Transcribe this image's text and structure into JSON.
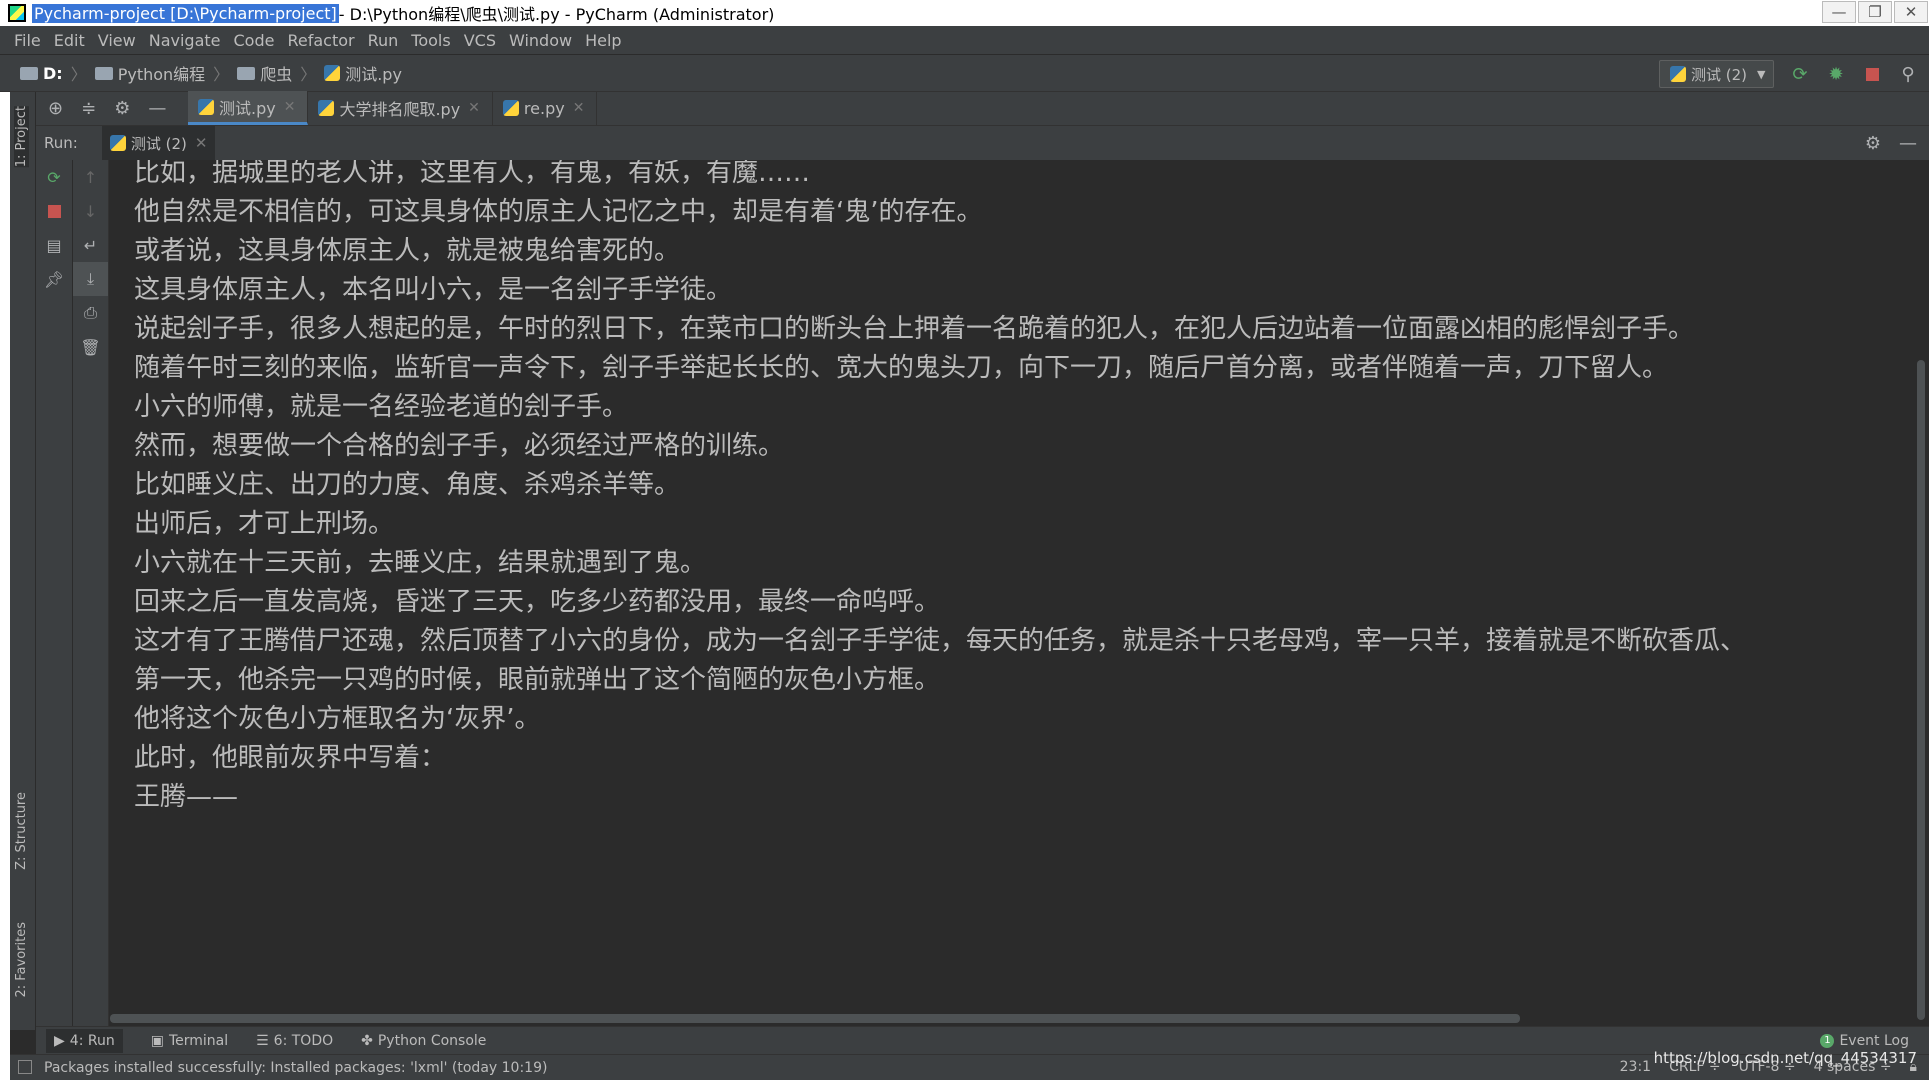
{
  "titlebar": {
    "project_highlight": "Pycharm-project [D:\\Pycharm-project]",
    "rest": " - D:\\Python编程\\爬虫\\测试.py - PyCharm (Administrator)",
    "minimize": "—",
    "maximize": "❐",
    "close": "✕"
  },
  "menu": [
    "File",
    "Edit",
    "View",
    "Navigate",
    "Code",
    "Refactor",
    "Run",
    "Tools",
    "VCS",
    "Window",
    "Help"
  ],
  "breadcrumb": [
    "D:",
    "Python编程",
    "爬虫",
    "测试.py"
  ],
  "run_config": {
    "label": "测试 (2)"
  },
  "side_labels": {
    "project": "1: Project",
    "structure": "Z: Structure",
    "favorites": "2: Favorites"
  },
  "editor_tabs": [
    "测试.py",
    "大学排名爬取.py",
    "re.py"
  ],
  "run_panel": {
    "label": "Run:",
    "tab": "测试 (2)"
  },
  "console_lines": [
    "比如，据城里的老人讲，这里有人，有鬼，有妖，有魔……",
    "他自然是不相信的，可这具身体的原主人记忆之中，却是有着‘鬼’的存在。",
    "或者说，这具身体原主人，就是被鬼给害死的。",
    "这具身体原主人，本名叫小六，是一名刽子手学徒。",
    "说起刽子手，很多人想起的是，午时的烈日下，在菜市口的断头台上押着一名跪着的犯人，在犯人后边站着一位面露凶相的彪悍刽子手。",
    "随着午时三刻的来临，监斩官一声令下，刽子手举起长长的、宽大的鬼头刀，向下一刀，随后尸首分离，或者伴随着一声，刀下留人。",
    "小六的师傅，就是一名经验老道的刽子手。",
    "然而，想要做一个合格的刽子手，必须经过严格的训练。",
    "比如睡义庄、出刀的力度、角度、杀鸡杀羊等。",
    "出师后，才可上刑场。",
    "小六就在十三天前，去睡义庄，结果就遇到了鬼。",
    "回来之后一直发高烧，昏迷了三天，吃多少药都没用，最终一命呜呼。",
    "这才有了王腾借尸还魂，然后顶替了小六的身份，成为一名刽子手学徒，每天的任务，就是杀十只老母鸡，宰一只羊，接着就是不断砍香瓜、",
    "第一天，他杀完一只鸡的时候，眼前就弹出了这个简陋的灰色小方框。",
    "他将这个灰色小方框取名为‘灰界’。",
    "此时，他眼前灰界中写着：",
    "王腾——"
  ],
  "bottom_tabs": [
    "4: Run",
    "Terminal",
    "6: TODO",
    "Python Console"
  ],
  "event_log": "Event Log",
  "status": {
    "message": "Packages installed successfully: Installed packages: 'lxml' (today 10:19)",
    "position": "23:1",
    "line_sep": "CRLF ÷",
    "encoding": "UTF-8 ÷",
    "indent": "4 spaces ÷"
  },
  "watermark": "https://blog.csdn.net/qq_44534317",
  "colors": {
    "accent": "#4a88c7",
    "run_green": "#59a869",
    "stop_red": "#c75450",
    "bg": "#2b2b2b",
    "panel": "#3c3f41"
  }
}
